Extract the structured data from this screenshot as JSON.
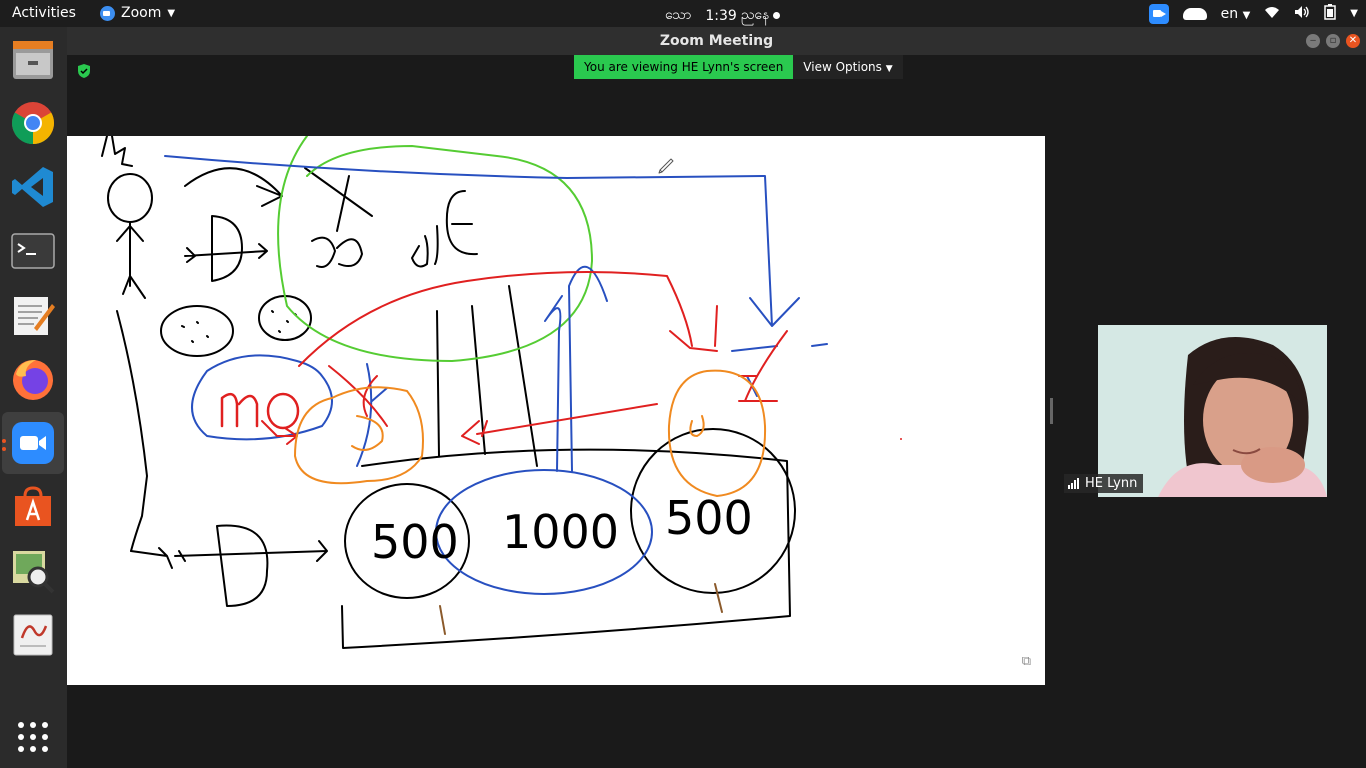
{
  "topbar": {
    "activities": "Activities",
    "app_name": "Zoom",
    "clock_prefix": "သော",
    "clock_time": "1:39",
    "clock_suffix": "ညနေ",
    "lang": "en"
  },
  "window": {
    "title": "Zoom Meeting"
  },
  "meeting": {
    "banner_text": "You are viewing HE Lynn's screen",
    "view_options": "View Options",
    "participant_name": "HE Lynn"
  },
  "whiteboard": {
    "circle_left": "500",
    "circle_middle": "1000",
    "circle_right": "500",
    "blue_label": "mo"
  },
  "dock": {
    "items": [
      "files-icon",
      "chrome-icon",
      "vscode-icon",
      "terminal-icon",
      "text-editor-icon",
      "firefox-icon",
      "zoom-icon",
      "software-center-icon",
      "image-viewer-icon",
      "document-viewer-icon",
      "app-grid-icon"
    ]
  },
  "colors": {
    "banner_green": "#2ac94f",
    "close_orange": "#e95420",
    "zoom_blue": "#2d8cff"
  }
}
